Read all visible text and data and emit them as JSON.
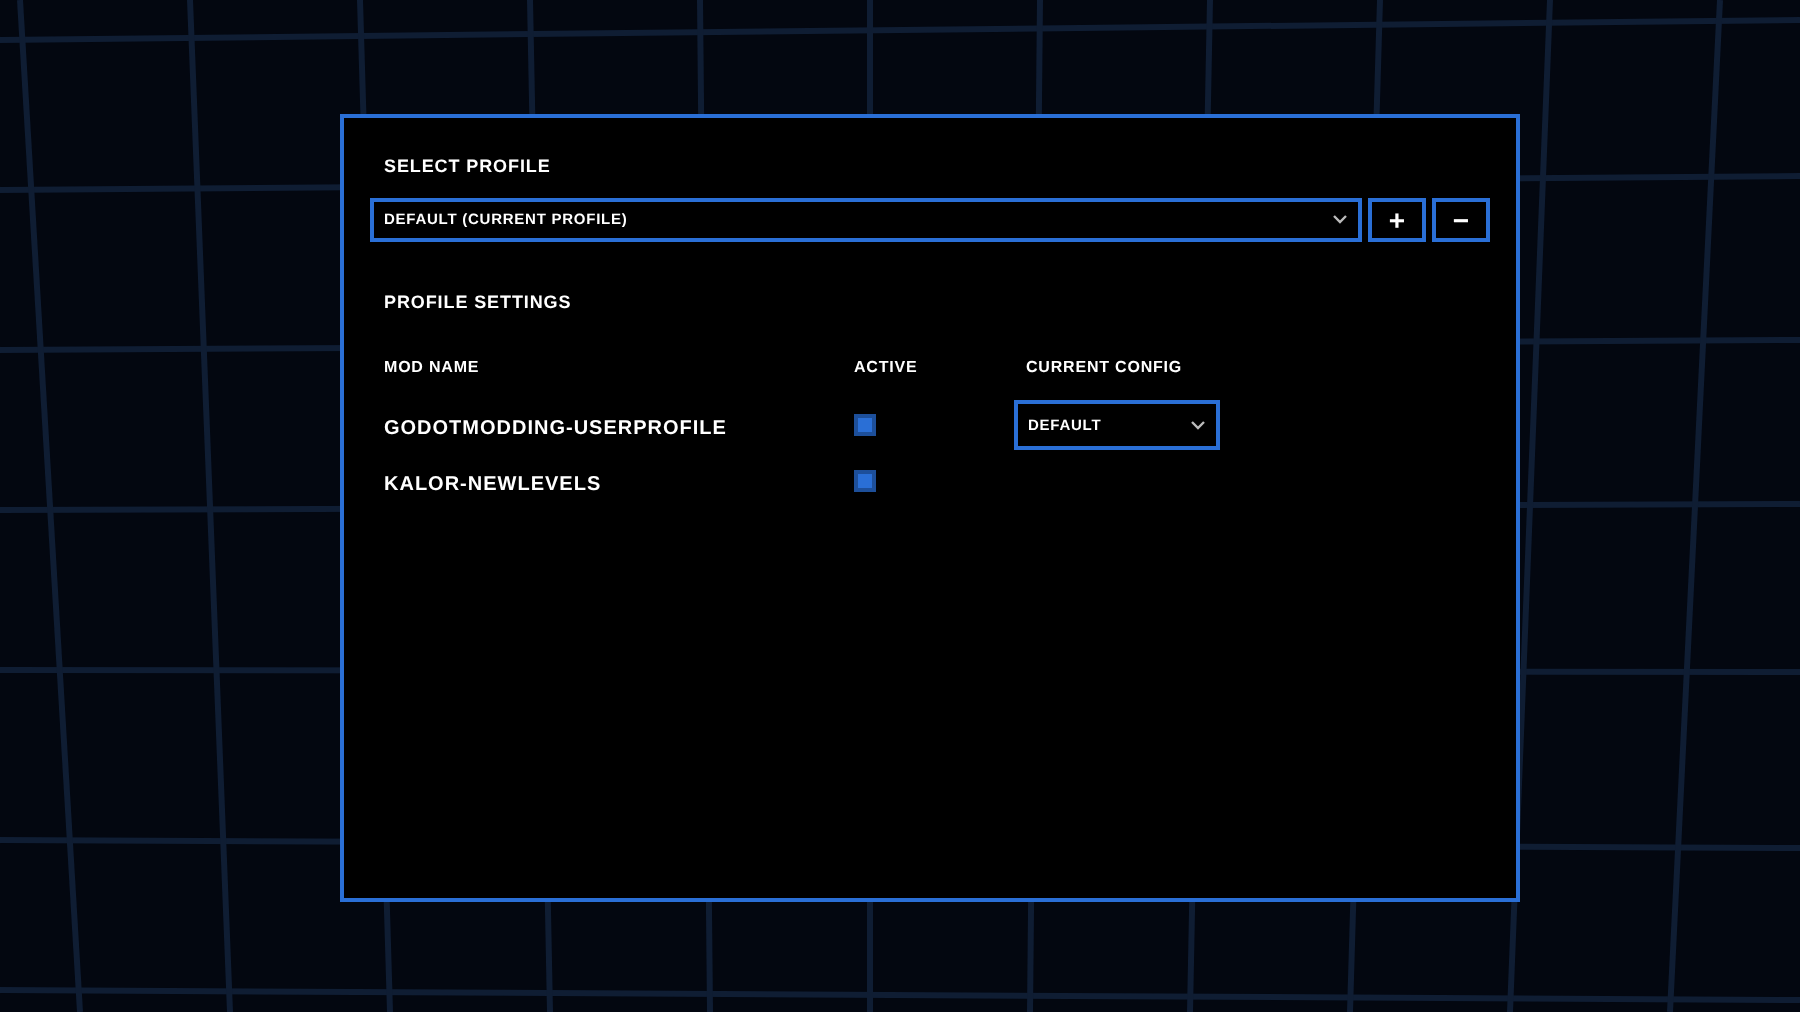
{
  "select_profile": {
    "label": "SELECT PROFILE",
    "dropdown": {
      "value": "DEFAULT (CURRENT PROFILE)"
    },
    "buttons": [
      "+",
      "−"
    ]
  },
  "profile_settings": {
    "title": "PROFILE SETTINGS",
    "columns": [
      "MOD NAME",
      "ACTIVE",
      "CURRENT CONFIG"
    ],
    "rows": [
      {
        "name": "GODOTMODDING-USERPROFILE",
        "checked": true,
        "config": "DEFAULT"
      },
      {
        "name": "KALOR-NEWLEVELS",
        "checked": true
      }
    ]
  }
}
